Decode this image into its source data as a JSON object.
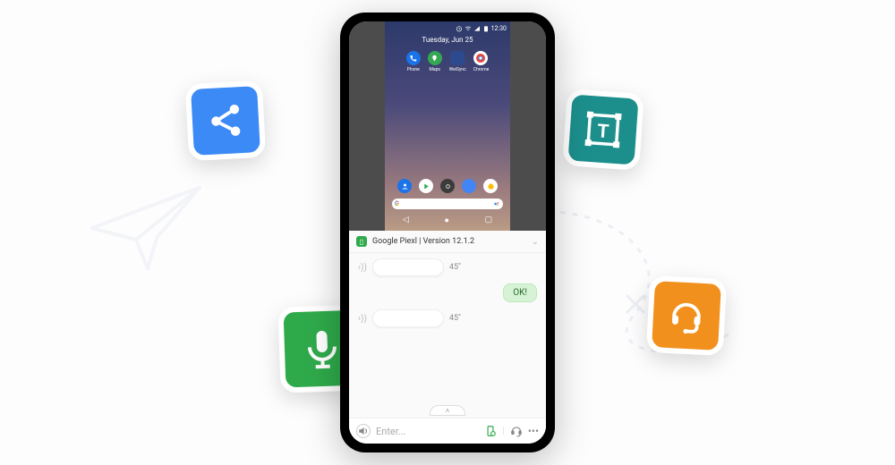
{
  "statusbar": {
    "time": "12:30"
  },
  "homescreen": {
    "date": "Tuesday, Jun 25",
    "apps": [
      {
        "name": "Phone"
      },
      {
        "name": "Maps"
      },
      {
        "name": "WeiSync"
      },
      {
        "name": "Chrome"
      }
    ]
  },
  "panel": {
    "device_name": "Google Piexl",
    "version_label": "Version 12.1.2",
    "separator": "  |  ",
    "messages": [
      {
        "side": "left",
        "type": "voice",
        "duration": "45''"
      },
      {
        "side": "right",
        "type": "text",
        "text": "OK!"
      },
      {
        "side": "left",
        "type": "voice",
        "duration": "45''"
      }
    ],
    "input_placeholder": "Enter..."
  },
  "tiles": {
    "share": "share-icon",
    "text": "text-box-icon",
    "mic": "microphone-icon",
    "support": "headset-icon"
  }
}
